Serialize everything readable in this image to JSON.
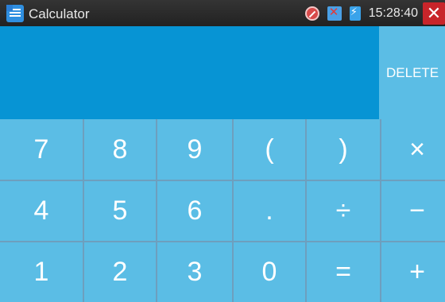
{
  "statusbar": {
    "title": "Calculator",
    "time": "15:28:40",
    "icons": [
      "calculator-app-icon",
      "no-disturb-icon",
      "network-off-icon",
      "battery-charging-icon",
      "close-icon"
    ],
    "close_glyph": "✕"
  },
  "display": {
    "value": ""
  },
  "delete_label": "DELETE",
  "keys": [
    [
      "7",
      "8",
      "9",
      "(",
      ")",
      "×"
    ],
    [
      "4",
      "5",
      "6",
      ".",
      "÷",
      "−"
    ],
    [
      "1",
      "2",
      "3",
      "0",
      "=",
      "+"
    ]
  ],
  "colors": {
    "statusbar": "#2b2b2b",
    "display": "#0794d4",
    "key": "#5bbde5",
    "key_text": "#ffffff",
    "close": "#c8252a"
  }
}
